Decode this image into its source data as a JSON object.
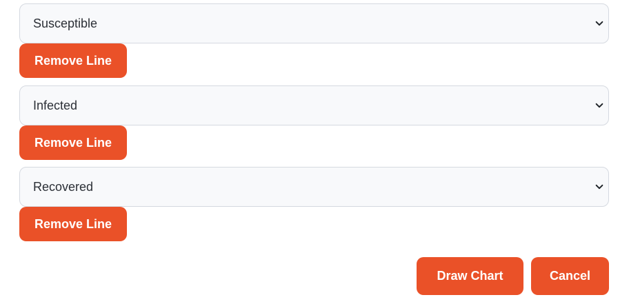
{
  "lines": [
    {
      "selected": "Susceptible",
      "remove_label": "Remove Line"
    },
    {
      "selected": "Infected",
      "remove_label": "Remove Line"
    },
    {
      "selected": "Recovered",
      "remove_label": "Remove Line"
    }
  ],
  "actions": {
    "draw_label": "Draw Chart",
    "cancel_label": "Cancel"
  },
  "colors": {
    "accent": "#ea5128",
    "select_bg": "#f8f9fb",
    "select_border": "#d5d9e0"
  },
  "icons": {
    "dropdown": "chevron-down-icon"
  }
}
